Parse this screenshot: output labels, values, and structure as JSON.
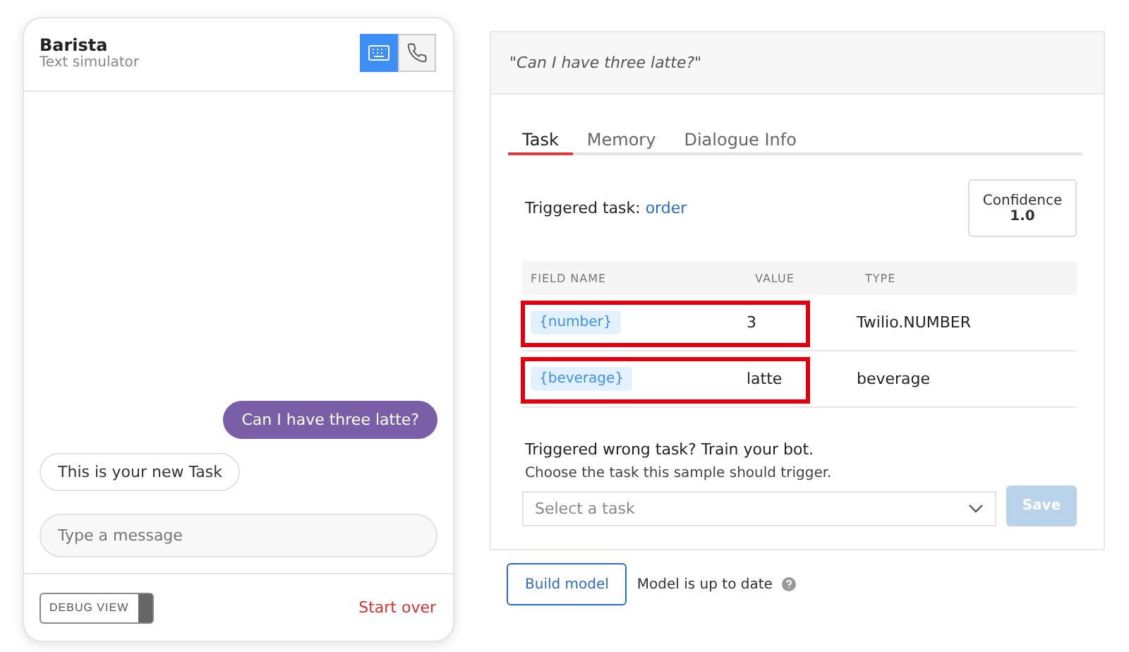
{
  "simulator": {
    "title": "Barista",
    "subtitle": "Text simulator",
    "modes": [
      {
        "kind": "keyboard",
        "selected": true
      },
      {
        "kind": "phone",
        "selected": false
      }
    ],
    "messages": [
      {
        "kind": "user",
        "text": "Can I have three latte?"
      },
      {
        "kind": "bot",
        "text": "This is your new Task"
      }
    ],
    "input": {
      "placeholder": "Type a message"
    },
    "debug_toggle": {
      "label": "DEBUG VIEW",
      "on": false
    },
    "start_over": "Start over"
  },
  "debug": {
    "utterance": "\"Can I have three latte?\"",
    "tabs": [
      {
        "label": "Task",
        "selected": true
      },
      {
        "label": "Memory",
        "selected": false
      },
      {
        "label": "Dialogue Info",
        "selected": false
      }
    ],
    "triggered_label": "Triggered task:",
    "triggered_task": "order",
    "confidence": {
      "label": "Confidence",
      "value": "1.0"
    },
    "table": {
      "columns": [
        "FIELD NAME",
        "VALUE",
        "TYPE"
      ],
      "rows": [
        {
          "field": "{number}",
          "value": "3",
          "type": "Twilio.NUMBER",
          "highlighted": true
        },
        {
          "field": "{beverage}",
          "value": "latte",
          "type": "beverage",
          "highlighted": true
        }
      ]
    },
    "train_title": "Triggered wrong task? Train your bot.",
    "train_hint": "Choose the task this sample should trigger.",
    "task_select": {
      "placeholder": "Select a task"
    },
    "save": {
      "label": "Save",
      "disabled": true
    }
  },
  "footer": {
    "build": "Build model",
    "status": "Model is up to date"
  }
}
